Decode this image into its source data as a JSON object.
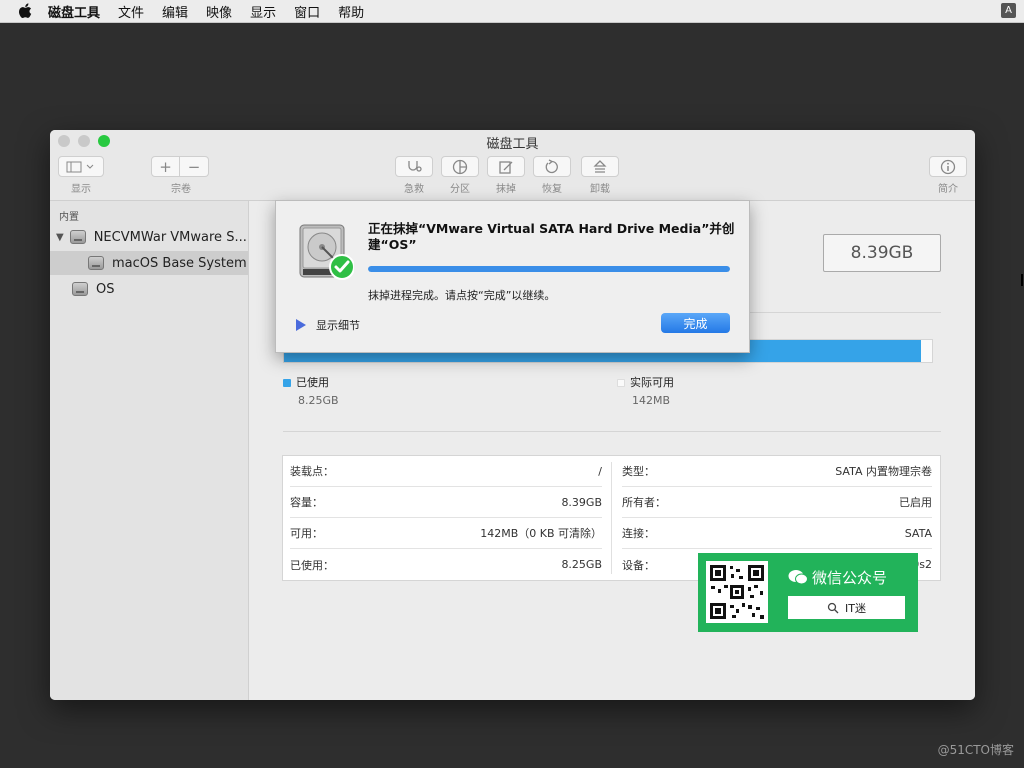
{
  "menubar": {
    "items": [
      "磁盘工具",
      "文件",
      "编辑",
      "映像",
      "显示",
      "窗口",
      "帮助"
    ],
    "input_badge": "A"
  },
  "window": {
    "title": "磁盘工具",
    "toolbar": {
      "view": "显示",
      "volume": "宗卷",
      "first_aid": "急救",
      "partition": "分区",
      "erase": "抹掉",
      "restore": "恢复",
      "unmount": "卸载",
      "info": "简介"
    },
    "sidebar": {
      "section": "内置",
      "items": [
        {
          "label": "NECVMWar VMware S..."
        },
        {
          "label": "macOS Base System"
        },
        {
          "label": "OS"
        }
      ]
    },
    "main": {
      "capacity": "8.39GB",
      "usage_fraction": 0.983,
      "usage_color": "#35a3e8",
      "used": {
        "label": "已使用",
        "value": "8.25GB"
      },
      "available": {
        "label": "实际可用",
        "value": "142MB"
      },
      "info_left": [
        {
          "label": "装载点：",
          "value": "/"
        },
        {
          "label": "容量：",
          "value": "8.39GB"
        },
        {
          "label": "可用：",
          "value": "142MB（0 KB 可清除）"
        },
        {
          "label": "已使用：",
          "value": "8.25GB"
        }
      ],
      "info_right": [
        {
          "label": "类型：",
          "value": "SATA 内置物理宗卷"
        },
        {
          "label": "所有者：",
          "value": "已启用"
        },
        {
          "label": "连接：",
          "value": "SATA"
        },
        {
          "label": "设备：",
          "value": "disk0s2"
        }
      ]
    }
  },
  "sheet": {
    "title": "正在抹掉“VMware Virtual SATA Hard Drive Media”并创建“OS”",
    "progress": 1.0,
    "message": "抹掉进程完成。请点按“完成”以继续。",
    "show_details": "显示细节",
    "done": "完成"
  },
  "overlay": {
    "wechat_title": "微信公众号",
    "wechat_search": "IT迷",
    "watermark": "@51CTO博客"
  }
}
